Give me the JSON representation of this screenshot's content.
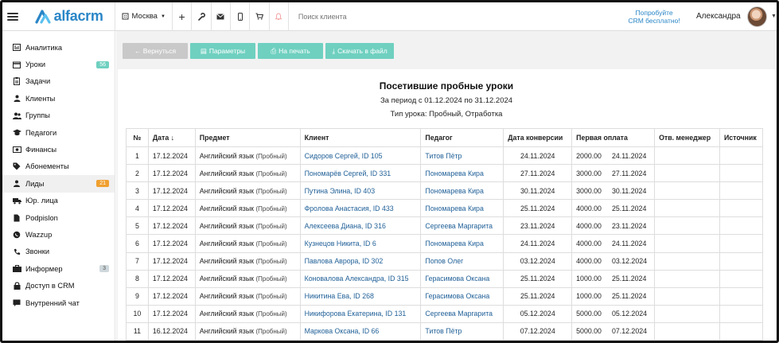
{
  "topbar": {
    "logo_text": "alfacrm",
    "city": "Москва",
    "search_placeholder": "Поиск клиента",
    "promo_line1": "Попробуйте",
    "promo_line2": "CRM бесплатно!",
    "user_name": "Александра"
  },
  "sidebar": {
    "items": [
      {
        "label": "Аналитика",
        "icon": "chart-icon"
      },
      {
        "label": "Уроки",
        "icon": "calendar-icon",
        "badge": "56",
        "badge_color": "#6fd0c0"
      },
      {
        "label": "Задачи",
        "icon": "clipboard-icon"
      },
      {
        "label": "Клиенты",
        "icon": "user-icon"
      },
      {
        "label": "Группы",
        "icon": "group-icon"
      },
      {
        "label": "Педагоги",
        "icon": "graduation-cap-icon"
      },
      {
        "label": "Финансы",
        "icon": "money-icon"
      },
      {
        "label": "Абонементы",
        "icon": "tag-icon"
      },
      {
        "label": "Лиды",
        "icon": "funnel-icon",
        "badge": "21",
        "badge_color": "#f0a030",
        "active": true
      },
      {
        "label": "Юр. лица",
        "icon": "truck-icon"
      },
      {
        "label": "Podpislon",
        "icon": "document-icon"
      },
      {
        "label": "Wazzup",
        "icon": "whatsapp-icon"
      },
      {
        "label": "Звонки",
        "icon": "phone-icon"
      },
      {
        "label": "Информер",
        "icon": "briefcase-icon",
        "badge": "3",
        "badge_color": "#cfd8dc",
        "badge_text_color": "#555"
      },
      {
        "label": "Доступ в CRM",
        "icon": "lock-icon"
      },
      {
        "label": "Внутренний чат",
        "icon": "chat-icon"
      }
    ]
  },
  "toolbar": {
    "back": "← Вернуться",
    "params": "Параметры",
    "print": "На печать",
    "download": "Скачать в файл"
  },
  "report": {
    "title": "Посетившие пробные уроки",
    "period": "За период с 01.12.2024 по 31.12.2024",
    "lesson_type": "Тип урока: Пробный, Отработка"
  },
  "table": {
    "headers": [
      "№",
      "Дата ↓",
      "Предмет",
      "Клиент",
      "Педагог",
      "Дата конверсии",
      "Первая оплата",
      "Отв. менеджер",
      "Источник"
    ],
    "rows": [
      {
        "n": "1",
        "date": "17.12.2024",
        "subject": "Английский язык",
        "subject_note": "(Пробный)",
        "client": "Сидоров Сергей, ID 105",
        "teacher": "Титов Пётр",
        "conv": "24.11.2024",
        "pay_sum": "2000.00",
        "pay_date": "24.11.2024",
        "manager": "",
        "source": ""
      },
      {
        "n": "2",
        "date": "17.12.2024",
        "subject": "Английский язык",
        "subject_note": "(Пробный)",
        "client": "Пономарёв Сергей, ID 331",
        "teacher": "Пономарева Кира",
        "conv": "27.11.2024",
        "pay_sum": "3000.00",
        "pay_date": "27.11.2024",
        "manager": "",
        "source": ""
      },
      {
        "n": "3",
        "date": "17.12.2024",
        "subject": "Английский язык",
        "subject_note": "(Пробный)",
        "client": "Путина Элина, ID 403",
        "teacher": "Пономарева Кира",
        "conv": "30.11.2024",
        "pay_sum": "3000.00",
        "pay_date": "30.11.2024",
        "manager": "",
        "source": ""
      },
      {
        "n": "4",
        "date": "17.12.2024",
        "subject": "Английский язык",
        "subject_note": "(Пробный)",
        "client": "Фролова Анастасия, ID 433",
        "teacher": "Пономарева Кира",
        "conv": "25.11.2024",
        "pay_sum": "4000.00",
        "pay_date": "25.11.2024",
        "manager": "",
        "source": ""
      },
      {
        "n": "5",
        "date": "17.12.2024",
        "subject": "Английский язык",
        "subject_note": "(Пробный)",
        "client": "Алексеева Диана, ID 316",
        "teacher": "Сергеева Маргарита",
        "conv": "23.11.2024",
        "pay_sum": "4000.00",
        "pay_date": "23.11.2024",
        "manager": "",
        "source": ""
      },
      {
        "n": "6",
        "date": "17.12.2024",
        "subject": "Английский язык",
        "subject_note": "(Пробный)",
        "client": "Кузнецов Никита, ID 6",
        "teacher": "Пономарева Кира",
        "conv": "24.11.2024",
        "pay_sum": "4000.00",
        "pay_date": "24.11.2024",
        "manager": "",
        "source": ""
      },
      {
        "n": "7",
        "date": "17.12.2024",
        "subject": "Английский язык",
        "subject_note": "(Пробный)",
        "client": "Павлова Аврора, ID 302",
        "teacher": "Попов Олег",
        "conv": "03.12.2024",
        "pay_sum": "4000.00",
        "pay_date": "03.12.2024",
        "manager": "",
        "source": ""
      },
      {
        "n": "8",
        "date": "17.12.2024",
        "subject": "Английский язык",
        "subject_note": "(Пробный)",
        "client": "Коновалова Александра, ID 315",
        "teacher": "Герасимова Оксана",
        "conv": "25.11.2024",
        "pay_sum": "1000.00",
        "pay_date": "25.11.2024",
        "manager": "",
        "source": ""
      },
      {
        "n": "9",
        "date": "17.12.2024",
        "subject": "Английский язык",
        "subject_note": "(Пробный)",
        "client": "Никитина Ева, ID 268",
        "teacher": "Герасимова Оксана",
        "conv": "25.11.2024",
        "pay_sum": "1000.00",
        "pay_date": "25.11.2024",
        "manager": "",
        "source": ""
      },
      {
        "n": "10",
        "date": "17.12.2024",
        "subject": "Английский язык",
        "subject_note": "(Пробный)",
        "client": "Никифорова Екатерина, ID 131",
        "teacher": "Сергеева Маргарита",
        "conv": "05.12.2024",
        "pay_sum": "5000.00",
        "pay_date": "05.12.2024",
        "manager": "",
        "source": ""
      },
      {
        "n": "11",
        "date": "16.12.2024",
        "subject": "Английский язык",
        "subject_note": "(Пробный)",
        "client": "Маркова Оксана, ID 66",
        "teacher": "Титов Пётр",
        "conv": "07.12.2024",
        "pay_sum": "5000.00",
        "pay_date": "07.12.2024",
        "manager": "",
        "source": ""
      }
    ]
  },
  "colors": {
    "brand": "#2a86c7",
    "teal": "#6fd0c0",
    "link": "#1f5f97"
  }
}
